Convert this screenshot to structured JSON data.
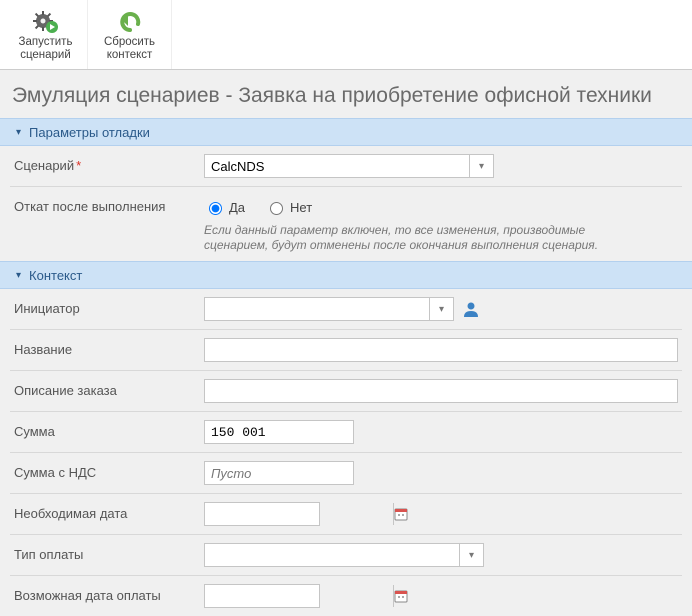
{
  "toolbar": {
    "run": {
      "label_line1": "Запустить",
      "label_line2": "сценарий"
    },
    "reset": {
      "label_line1": "Сбросить",
      "label_line2": "контекст"
    }
  },
  "page_title": "Эмуляция сценариев - Заявка на приобретение офисной техники",
  "sections": {
    "debug": "Параметры отладки",
    "context": "Контекст"
  },
  "debug": {
    "scenario_label": "Сценарий",
    "scenario_value": "CalcNDS",
    "rollback_label": "Откат после выполнения",
    "rollback_yes": "Да",
    "rollback_no": "Нет",
    "rollback_checked": "yes",
    "rollback_hint": "Если данный параметр включен, то все изменения, производимые сценарием, будут отменены после окончания выполнения сценария."
  },
  "context": {
    "initiator_label": "Инициатор",
    "initiator_value": "",
    "name_label": "Название",
    "name_value": "",
    "order_desc_label": "Описание заказа",
    "order_desc_value": "",
    "sum_label": "Сумма",
    "sum_value": "150 001",
    "sum_nds_label": "Сумма с НДС",
    "sum_nds_value": "Пусто",
    "need_date_label": "Необходимая дата",
    "need_date_value": "",
    "pay_type_label": "Тип оплаты",
    "pay_type_value": "",
    "pay_date_label": "Возможная дата оплаты",
    "pay_date_value": ""
  }
}
